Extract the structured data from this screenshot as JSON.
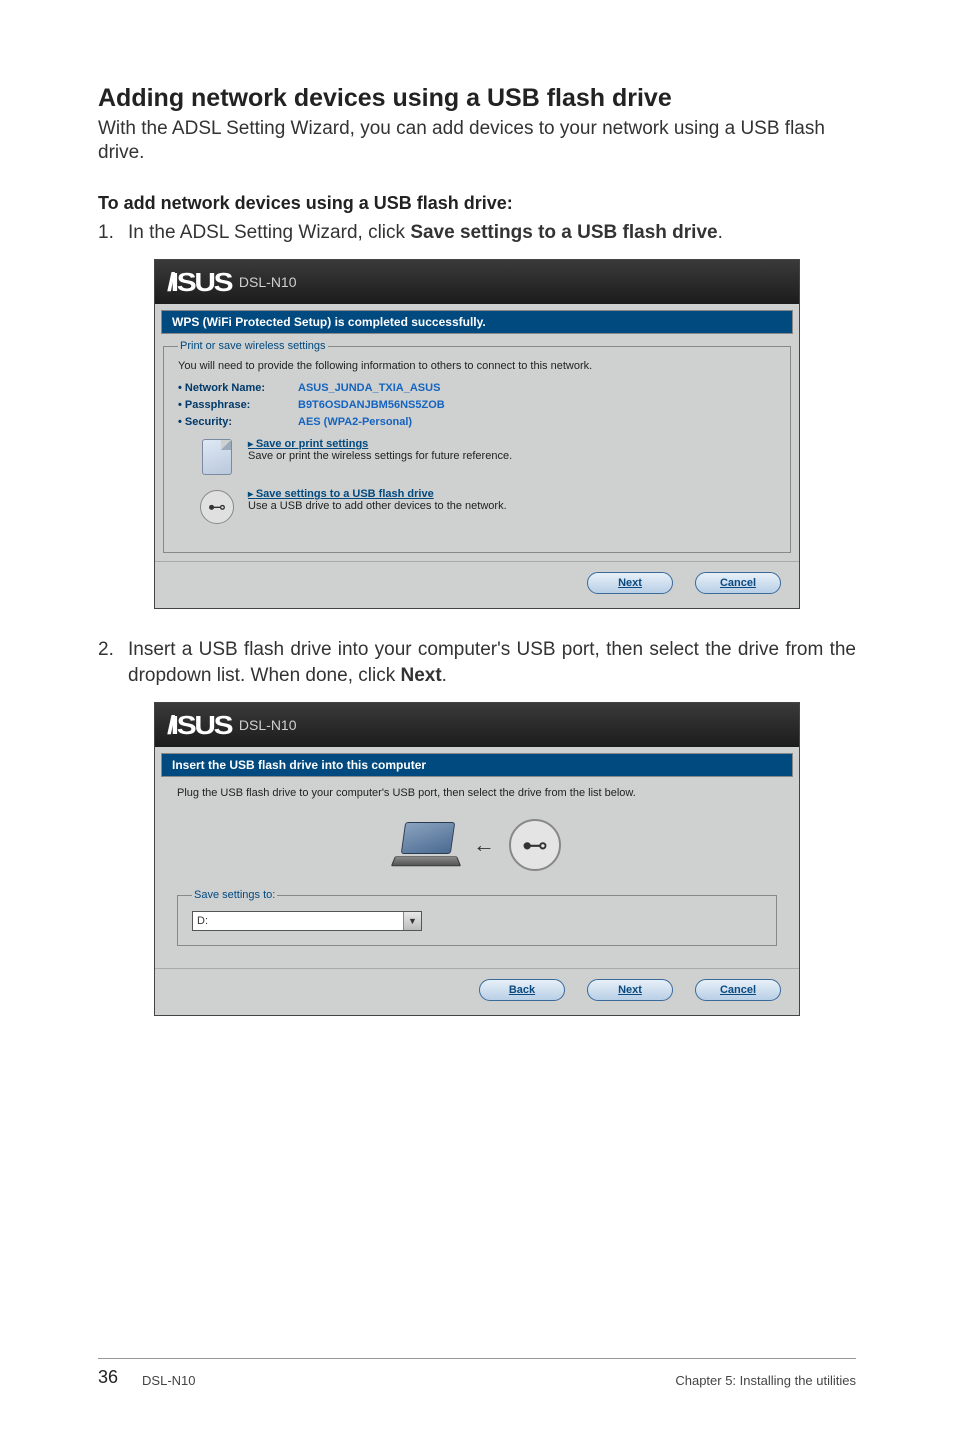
{
  "page": {
    "title": "Adding network devices using a USB flash drive",
    "intro": "With the ADSL Setting Wizard, you can add devices to your network using a USB flash drive.",
    "sub_heading": "To add network devices using a USB flash drive:",
    "step1_prefix": "In the ADSL Setting Wizard, click ",
    "step1_bold": "Save settings to a USB flash drive",
    "step1_suffix": ".",
    "step2_prefix": "Insert a USB flash drive into your computer's USB port, then select the drive from the dropdown list. When done, click ",
    "step2_bold": "Next",
    "step2_suffix": ".",
    "num1": "1.",
    "num2": "2."
  },
  "wizard1": {
    "brand": "ISUS",
    "model": "DSL-N10",
    "banner": "WPS (WiFi Protected Setup) is completed successfully.",
    "group_legend": "Print or save wireless settings",
    "info_line": "You will need to provide the following information to others to connect to this network.",
    "kv": {
      "net_label": "Network Name:",
      "net_value": "ASUS_JUNDA_TXIA_ASUS",
      "pass_label": "Passphrase:",
      "pass_value": "B9T6OSDANJBM56NS5ZOB",
      "sec_label": "Security:",
      "sec_value": "AES (WPA2-Personal)"
    },
    "action_print": {
      "heading": "Save or print settings",
      "desc": "Save or print the wireless settings for future reference."
    },
    "action_usb": {
      "heading": "Save settings to a USB flash drive",
      "desc": "Use a USB drive to add other devices to the network."
    },
    "buttons": {
      "next": "Next",
      "cancel": "Cancel"
    }
  },
  "wizard2": {
    "brand": "ISUS",
    "model": "DSL-N10",
    "banner": "Insert the USB flash drive into this computer",
    "plug_text": "Plug the USB flash drive to your computer's USB port, then select the drive from the list below.",
    "save_legend": "Save settings to:",
    "drive_value": "D:",
    "buttons": {
      "back": "Back",
      "next": "Next",
      "cancel": "Cancel"
    }
  },
  "footer": {
    "page_number": "36",
    "product": "DSL-N10",
    "chapter": "Chapter 5: Installing the utilities"
  }
}
